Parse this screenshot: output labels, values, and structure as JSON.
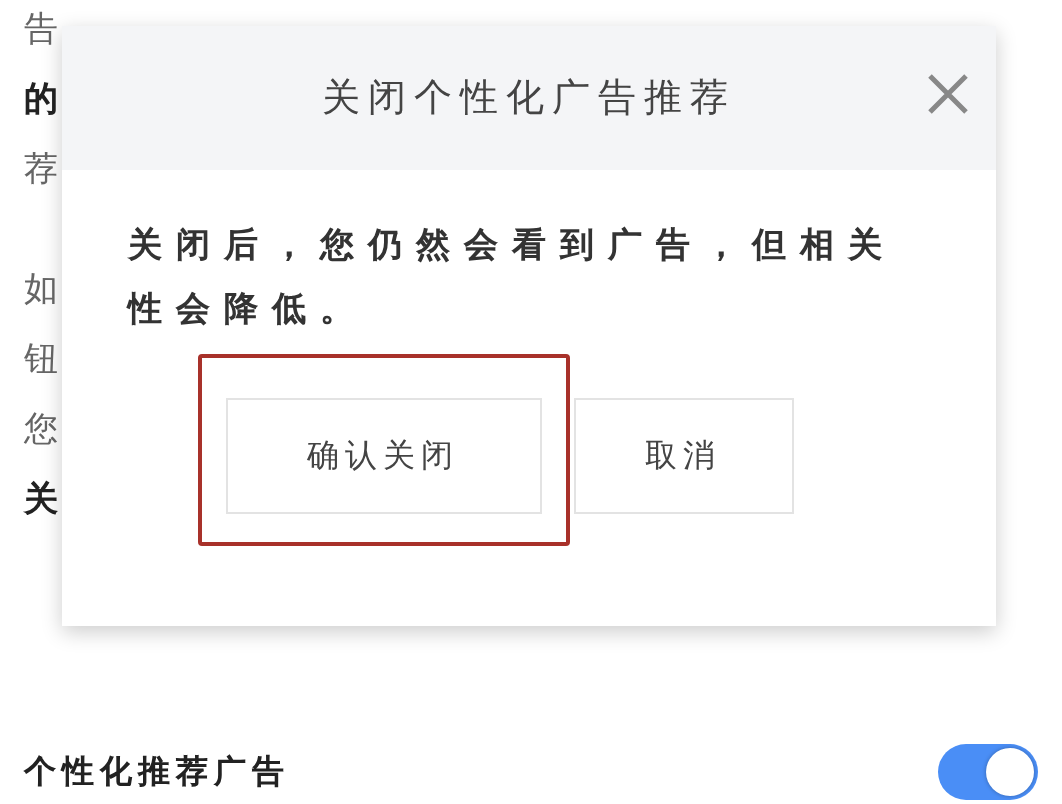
{
  "background": {
    "paragraphs": [
      [
        {
          "text": "告",
          "bold": false
        },
        {
          "text": "的",
          "bold": true
        },
        {
          "text": "荐",
          "bold": false
        }
      ],
      [
        {
          "text": "如",
          "bold": false
        },
        {
          "text": "钮",
          "bold": false
        },
        {
          "text": "您",
          "bold": false
        },
        {
          "text": "关",
          "bold": true
        }
      ]
    ],
    "setting": {
      "label": "个性化推荐广告",
      "on": true
    }
  },
  "dialog": {
    "title": "关闭个性化广告推荐",
    "message": "关闭后，您仍然会看到广告，但相关性会降低。",
    "buttons": [
      {
        "label": "确认关闭",
        "highlighted": true
      },
      {
        "label": "取消",
        "highlighted": false
      }
    ]
  }
}
